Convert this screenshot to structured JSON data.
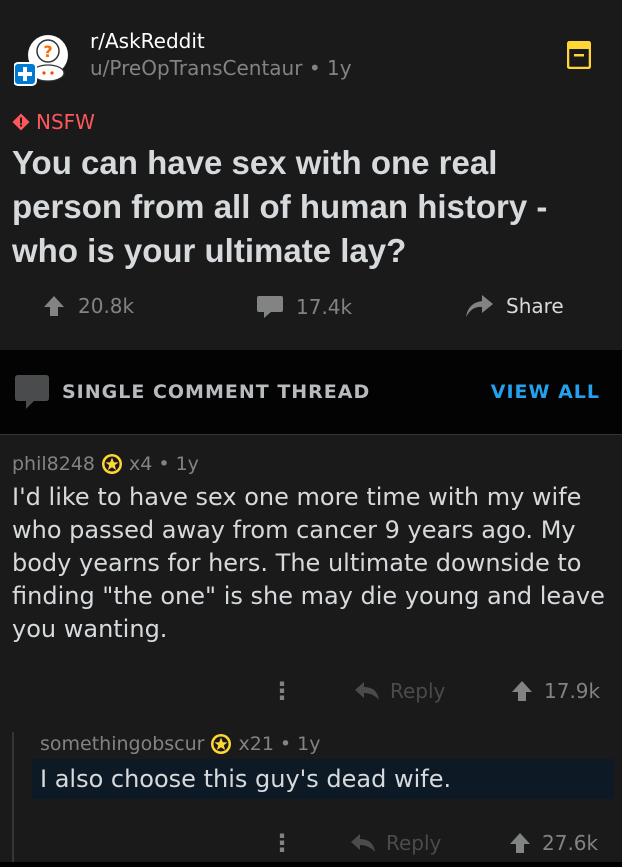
{
  "post": {
    "subreddit": "r/AskReddit",
    "author": "u/PreOpTransCentaur",
    "age": "1y",
    "nsfw_label": "NSFW",
    "title": "You can have sex with one real person from all of human history - who is your ultimate lay?",
    "upvotes": "20.8k",
    "comments": "17.4k",
    "share_label": "Share"
  },
  "thread_bar": {
    "label": "SINGLE COMMENT THREAD",
    "view_all": "VIEW ALL"
  },
  "comments": [
    {
      "author": "phil8248",
      "award_count": "x4",
      "age": "1y",
      "body": "I'd like to have sex one more time with my wife who passed away from cancer 9 years ago. My body yearns for hers. The ultimate downside to finding \"the one\" is she may die young and leave you wanting.",
      "reply_label": "Reply",
      "votes": "17.9k"
    },
    {
      "author": "somethingobscur",
      "award_count": "x21",
      "age": "1y",
      "body": "I also choose this guy's dead wife.",
      "reply_label": "Reply",
      "votes": "27.6k"
    }
  ],
  "colors": {
    "accent_blue": "#24a0ed",
    "nsfw_red": "#ff585b",
    "save_yellow": "#ffd635"
  }
}
